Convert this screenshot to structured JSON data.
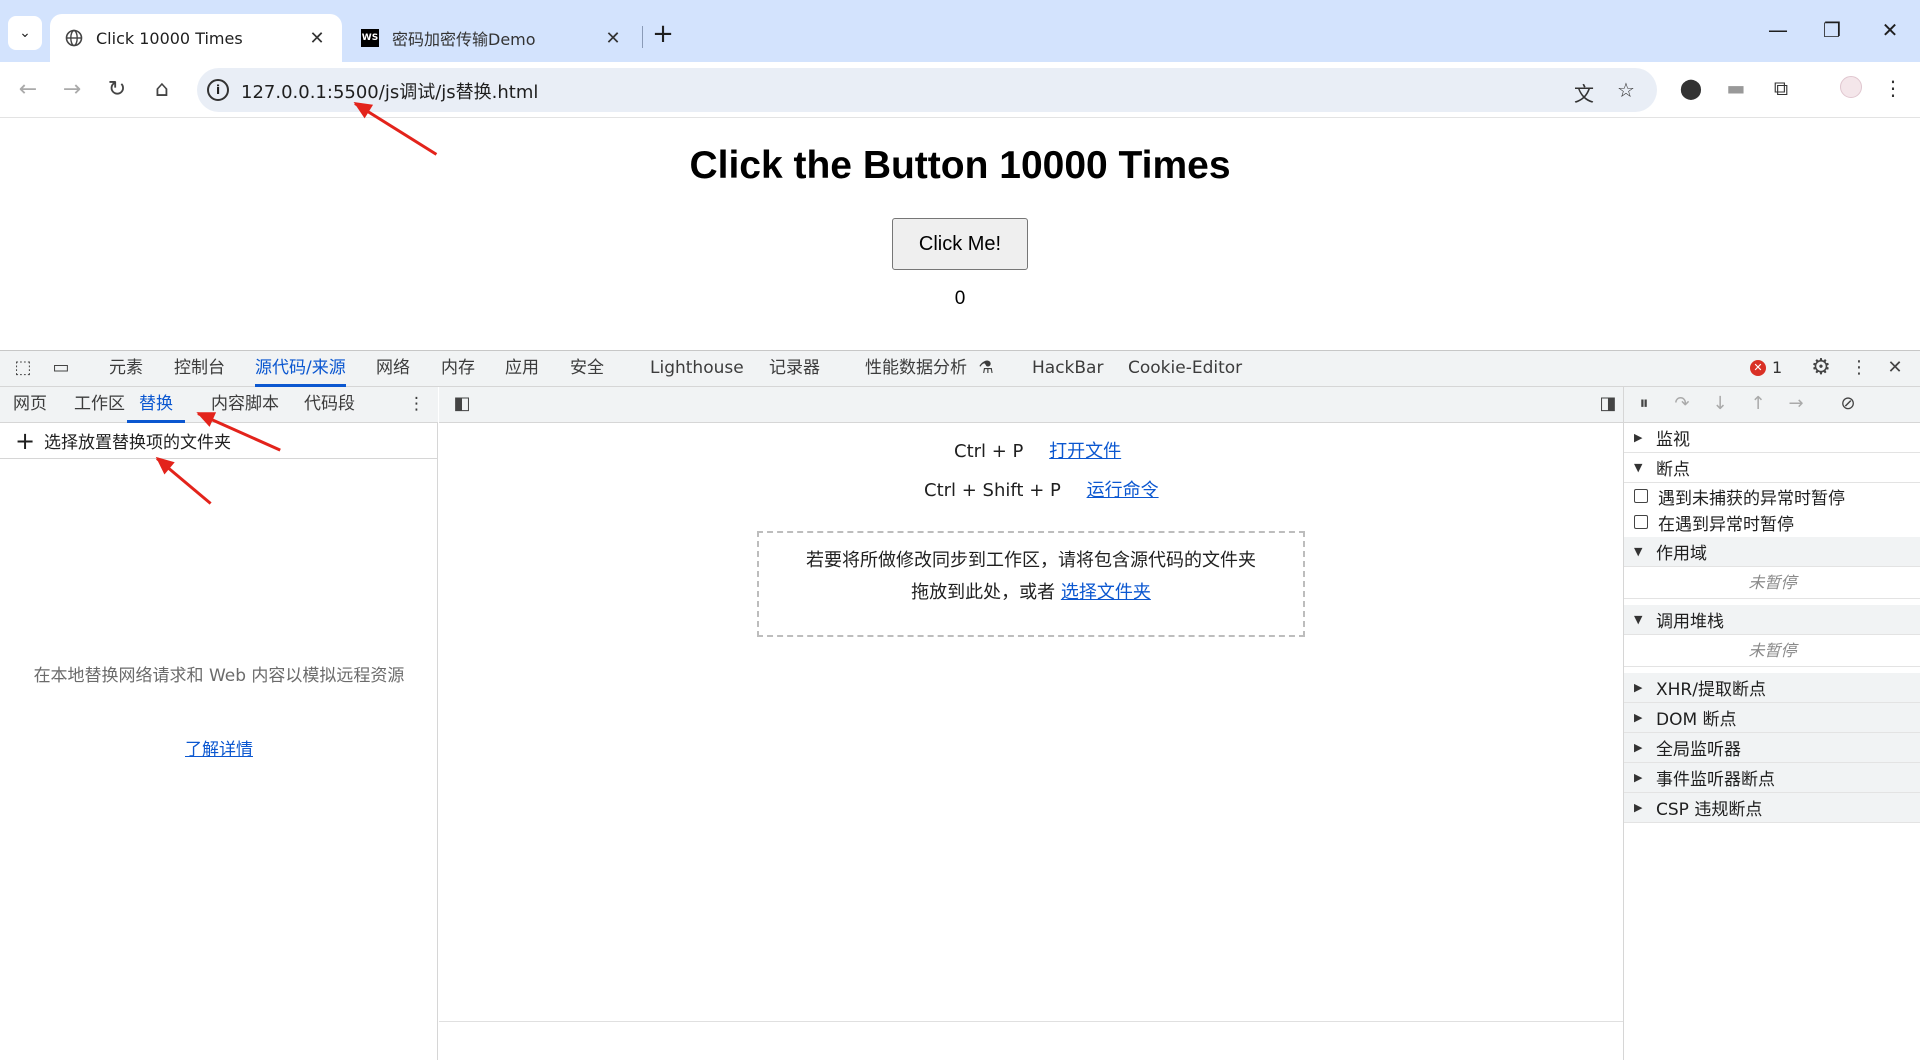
{
  "browser": {
    "tabs": [
      {
        "title": "Click 10000 Times",
        "active": true
      },
      {
        "title": "密码加密传输Demo",
        "active": false,
        "favicon_text": "WS"
      }
    ],
    "url": "127.0.0.1:5500/js调试/js替换.html"
  },
  "page": {
    "heading": "Click the Button 10000 Times",
    "button_label": "Click Me!",
    "count": "0"
  },
  "devtools": {
    "panels": [
      "元素",
      "控制台",
      "源代码/来源",
      "网络",
      "内存",
      "应用",
      "安全",
      "Lighthouse",
      "记录器",
      "性能数据分析",
      "HackBar",
      "Cookie-Editor"
    ],
    "selected_panel": "源代码/来源",
    "error_count": "1",
    "navigator_tabs": [
      "网页",
      "工作区",
      "替换",
      "内容脚本",
      "代码段"
    ],
    "selected_navigator_tab": "替换",
    "add_folder_label": "选择放置替换项的文件夹",
    "empty_text": "在本地替换网络请求和 Web 内容以模拟远程资源",
    "learn_more": "了解详情",
    "shortcuts": [
      {
        "keys": "Ctrl + P",
        "action": "打开文件"
      },
      {
        "keys": "Ctrl + Shift + P",
        "action": "运行命令"
      }
    ],
    "dropzone_line1": "若要将所做修改同步到工作区，请将包含源代码的文件夹",
    "dropzone_line2": "拖放到此处，或者",
    "dropzone_link": "选择文件夹",
    "debugger": {
      "watch": "监视",
      "breakpoints": "断点",
      "pause_uncaught": "遇到未捕获的异常时暂停",
      "pause_caught": "在遇到异常时暂停",
      "scope": "作用域",
      "not_paused": "未暂停",
      "call_stack": "调用堆栈",
      "xhr": "XHR/提取断点",
      "dom": "DOM 断点",
      "global": "全局监听器",
      "event": "事件监听器断点",
      "csp": "CSP 违规断点"
    }
  }
}
